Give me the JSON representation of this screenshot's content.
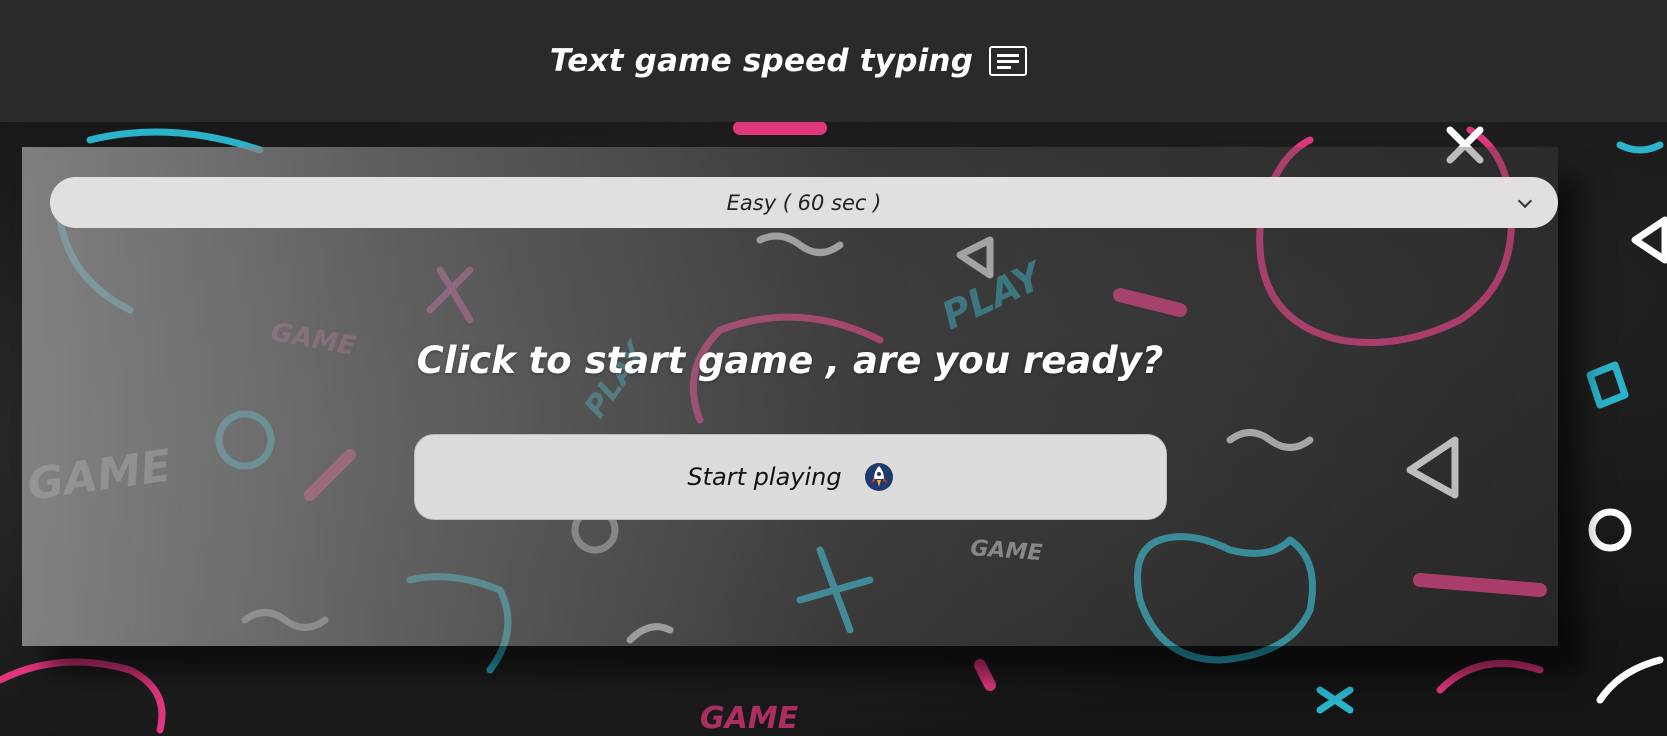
{
  "header": {
    "title": "Text game speed typing",
    "icon": "notes-icon"
  },
  "difficulty": {
    "selected": "Easy ( 60 sec )",
    "icon": "chevron-down-icon"
  },
  "main": {
    "prompt": "Click to start game , are you ready?",
    "start_button": {
      "label": "Start playing",
      "icon": "rocket-icon"
    }
  },
  "background": {
    "words": [
      "GAME",
      "PLAY",
      "GAME",
      "PLAY",
      "GAME",
      "GAME"
    ]
  },
  "colors": {
    "header_bg": "#2a2a2a",
    "neon_pink": "#e0367e",
    "neon_cyan": "#2bb3c9",
    "select_bg": "#e2dfdf",
    "button_bg": "#dcdcdc"
  }
}
